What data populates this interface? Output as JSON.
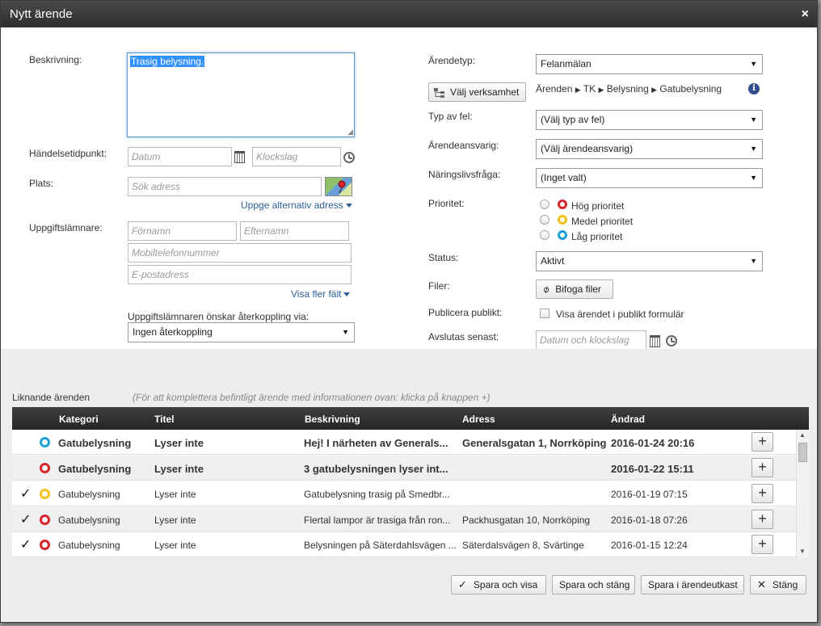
{
  "dialog": {
    "title": "Nytt ärende",
    "close": "×"
  },
  "left": {
    "description_label": "Beskrivning:",
    "description_value": "Trasig belysning.",
    "event_time_label": "Händelsetidpunkt:",
    "date_placeholder": "Datum",
    "time_placeholder": "Klockslag",
    "place_label": "Plats:",
    "address_placeholder": "Sök adress",
    "alt_address_link": "Uppge alternativ adress",
    "informant_label": "Uppgiftslämnare:",
    "firstname_placeholder": "Förnamn",
    "lastname_placeholder": "Efternamn",
    "mobile_placeholder": "Mobiltelefonnummer",
    "email_placeholder": "E-postadress",
    "more_fields_link": "Visa fler fält",
    "feedback_label": "Uppgiftslämnaren önskar återkoppling via:",
    "feedback_value": "Ingen återkoppling"
  },
  "right": {
    "case_type_label": "Ärendetyp:",
    "case_type_value": "Felanmälan",
    "choose_activity_button": "Välj verksamhet",
    "breadcrumb": [
      "Ärenden",
      "TK",
      "Belysning",
      "Gatubelysning"
    ],
    "breadcrumb_sep": "▶",
    "fault_type_label": "Typ av fel:",
    "fault_type_value": "(Välj typ av fel)",
    "responsible_label": "Ärendeansvarig:",
    "responsible_value": "(Välj ärendeansvarig)",
    "business_label": "Näringslivsfråga:",
    "business_value": "(Inget valt)",
    "priority_label": "Prioritet:",
    "priorities": [
      {
        "label": "Hög prioritet",
        "color": "#d7262b"
      },
      {
        "label": "Medel prioritet",
        "color": "#f2c21b"
      },
      {
        "label": "Låg prioritet",
        "color": "#1fa0d6"
      }
    ],
    "status_label": "Status:",
    "status_value": "Aktivt",
    "files_label": "Filer:",
    "attach_button": "Bifoga filer",
    "publish_label": "Publicera publikt:",
    "publish_checkbox_label": "Visa ärendet i publikt formulär",
    "close_by_label": "Avslutas senast:",
    "close_by_placeholder": "Datum och klockslag"
  },
  "similar": {
    "title": "Liknande ärenden",
    "hint": "(För att komplettera befintligt ärende med informationen ovan: klicka på knappen +)",
    "columns": [
      "Kategori",
      "Titel",
      "Beskrivning",
      "Adress",
      "Ändrad"
    ],
    "rows": [
      {
        "check": "",
        "color": "#1fa0d6",
        "category": "Gatubelysning",
        "title": "Lyser inte",
        "description": "Hej! I närheten av Generals...",
        "address": "Generalsgatan 1, Norrköping",
        "changed": "2016-01-24 20:16",
        "bold": true
      },
      {
        "check": "",
        "color": "#d7262b",
        "category": "Gatubelysning",
        "title": "Lyser inte",
        "description": "3 gatubelysningen lyser int...",
        "address": "",
        "changed": "2016-01-22 15:11",
        "bold": true
      },
      {
        "check": "✓",
        "color": "#f2c21b",
        "category": "Gatubelysning",
        "title": "Lyser inte",
        "description": "Gatubelysning trasig på Smedbr...",
        "address": "",
        "changed": "2016-01-19 07:15",
        "bold": false
      },
      {
        "check": "✓",
        "color": "#d7262b",
        "category": "Gatubelysning",
        "title": "Lyser inte",
        "description": "Flertal lampor är trasiga från ron...",
        "address": "Packhusgatan 10, Norrköping",
        "changed": "2016-01-18 07:26",
        "bold": false
      },
      {
        "check": "✓",
        "color": "#d7262b",
        "category": "Gatubelysning",
        "title": "Lyser inte",
        "description": "Belysningen på Säterdahlsvägen ...",
        "address": "Säterdalsvägen 8, Svärtinge",
        "changed": "2016-01-15 12:24",
        "bold": false
      }
    ],
    "add_label": "+"
  },
  "footer": {
    "save_view": "Spara och visa",
    "save_close": "Spara och stäng",
    "save_draft": "Spara i ärendeutkast",
    "close": "Stäng"
  },
  "colors": {
    "accent_link": "#2d5f9a",
    "header_dark": "#2e2e2e"
  }
}
